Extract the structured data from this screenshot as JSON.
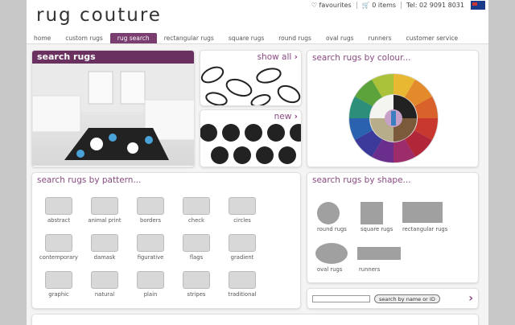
{
  "brand": {
    "logo": "rug couture",
    "accent": "#7a3d70"
  },
  "topbar": {
    "favourites": "favourites",
    "cart": "0 items",
    "phone": "Tel: 02 9091 8031"
  },
  "nav": [
    "home",
    "custom rugs",
    "rug search",
    "rectangular rugs",
    "square rugs",
    "round rugs",
    "oval rugs",
    "runners",
    "customer service"
  ],
  "nav_active": "rug search",
  "hero": {
    "title": "search rugs"
  },
  "showall": {
    "label": "show all"
  },
  "new": {
    "label": "new"
  },
  "colour": {
    "title": "search rugs by colour..."
  },
  "pattern": {
    "title": "search rugs by pattern...",
    "items": [
      "abstract",
      "animal print",
      "borders",
      "check",
      "circles",
      "contemporary",
      "damask",
      "figurative",
      "flags",
      "gradient",
      "graphic",
      "natural",
      "plain",
      "stripes",
      "traditional"
    ]
  },
  "shape": {
    "title": "search rugs by shape...",
    "items": [
      "round rugs",
      "square rugs",
      "rectangular rugs",
      "oval rugs",
      "runners"
    ]
  },
  "search": {
    "button": "search by name or ID",
    "placeholder": ""
  }
}
